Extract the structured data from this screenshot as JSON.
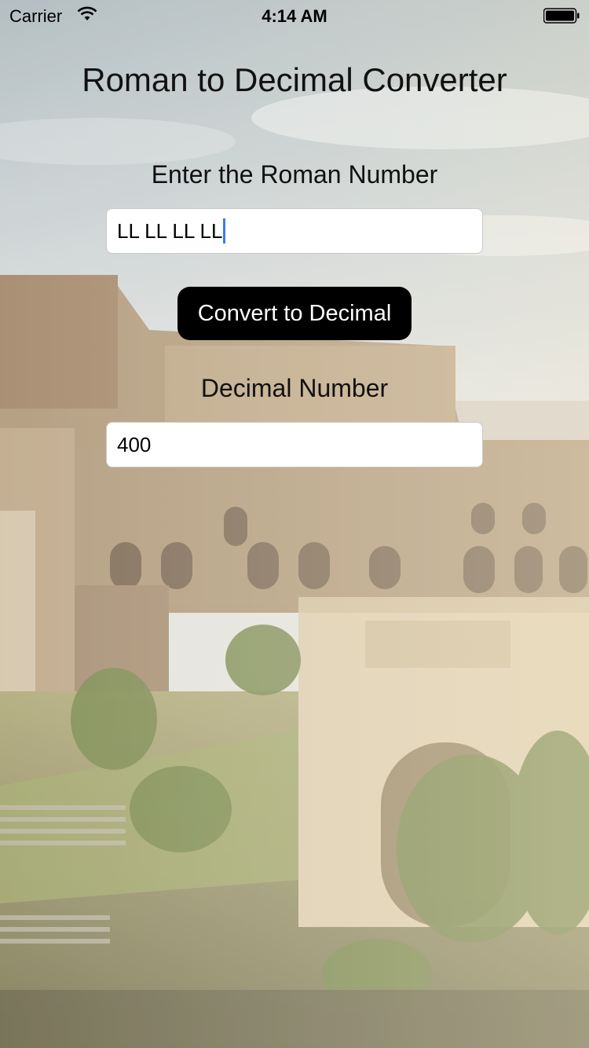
{
  "status_bar": {
    "carrier": "Carrier",
    "time": "4:14 AM"
  },
  "app": {
    "title": "Roman to Decimal Converter",
    "roman_label": "Enter the Roman Number",
    "roman_value": "LL LL LL LL",
    "convert_button": "Convert to Decimal",
    "decimal_label": "Decimal Number",
    "decimal_value": "400"
  },
  "colors": {
    "button_bg": "#000000",
    "caret": "#3b7bf6"
  },
  "icons": [
    "wifi-icon",
    "battery-icon"
  ],
  "background": "colosseum-photo"
}
